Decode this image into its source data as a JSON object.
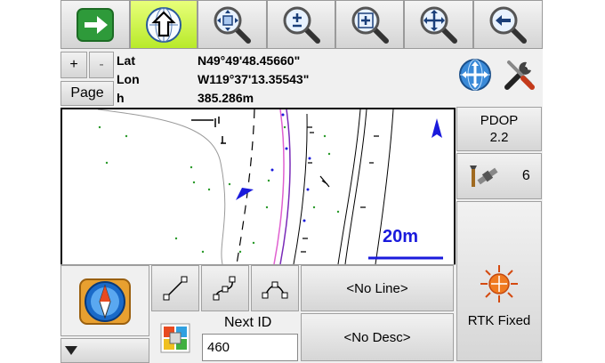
{
  "coords": {
    "lat_label": "Lat",
    "lat_value": "N49°49'48.45660\"",
    "lon_label": "Lon",
    "lon_value": "W119°37'13.35543\"",
    "h_label": "h",
    "h_value": "385.286m"
  },
  "zoom_controls": {
    "plus": "+",
    "minus": "-",
    "page": "Page"
  },
  "toolbar": {
    "icons": [
      "next-arrow-icon",
      "north-up-icon",
      "zoom-fit-icon",
      "zoom-in-out-icon",
      "zoom-window-icon",
      "pan-icon",
      "back-arrow-icon"
    ],
    "active_index": 1
  },
  "status": {
    "pdop_label": "PDOP",
    "pdop_value": "2.2",
    "satellites": "6",
    "rtk_status": "RTK Fixed"
  },
  "map": {
    "scale_label": "20m"
  },
  "bottom": {
    "line_button": "<No Line>",
    "desc_button": "<No Desc>",
    "next_id_label": "Next ID",
    "next_id_value": "460"
  },
  "colors": {
    "active_tool": "#c6f03a",
    "scale_bar": "#1a1adc",
    "map_border": "#000000"
  }
}
